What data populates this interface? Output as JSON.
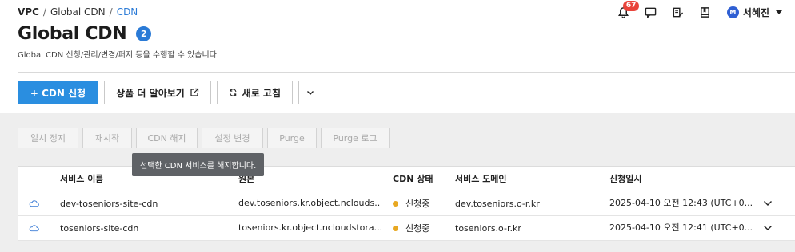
{
  "breadcrumb": {
    "root": "VPC",
    "sep": "/",
    "parent": "Global CDN",
    "current": "CDN"
  },
  "header": {
    "notification_count": "67",
    "user_initial": "M",
    "user_name": "서혜진"
  },
  "page": {
    "title": "Global CDN",
    "count": "2",
    "subtitle": "Global CDN 신청/관리/변경/퍼지 등을 수행할 수 있습니다."
  },
  "actions": {
    "apply": "+ CDN 신청",
    "learn_more": "상품 더 알아보기",
    "refresh": "새로 고침"
  },
  "toolbar": [
    "일시 정지",
    "재시작",
    "CDN 해지",
    "설정 변경",
    "Purge",
    "Purge 로그"
  ],
  "tooltip": "선택한 CDN 서비스를 해지합니다.",
  "table": {
    "headers": {
      "name": "서비스 이름",
      "origin": "원본",
      "status": "CDN 상태",
      "domain": "서비스 도메인",
      "date": "신청일시"
    },
    "rows": [
      {
        "name": "dev-toseniors-site-cdn",
        "origin": "dev.toseniors.kr.object.nclouds...",
        "status": "신청중",
        "domain": "dev.toseniors.o-r.kr",
        "date": "2025-04-10 오전 12:43 (UTC+0..."
      },
      {
        "name": "toseniors-site-cdn",
        "origin": "toseniors.kr.object.ncloudstora...",
        "status": "신청중",
        "domain": "toseniors.o-r.kr",
        "date": "2025-04-10 오전 12:41 (UTC+0..."
      }
    ]
  },
  "colors": {
    "primary": "#2a8ee0",
    "link": "#2a7ad6",
    "badge": "#e9443b",
    "status_pending": "#e8a822"
  }
}
